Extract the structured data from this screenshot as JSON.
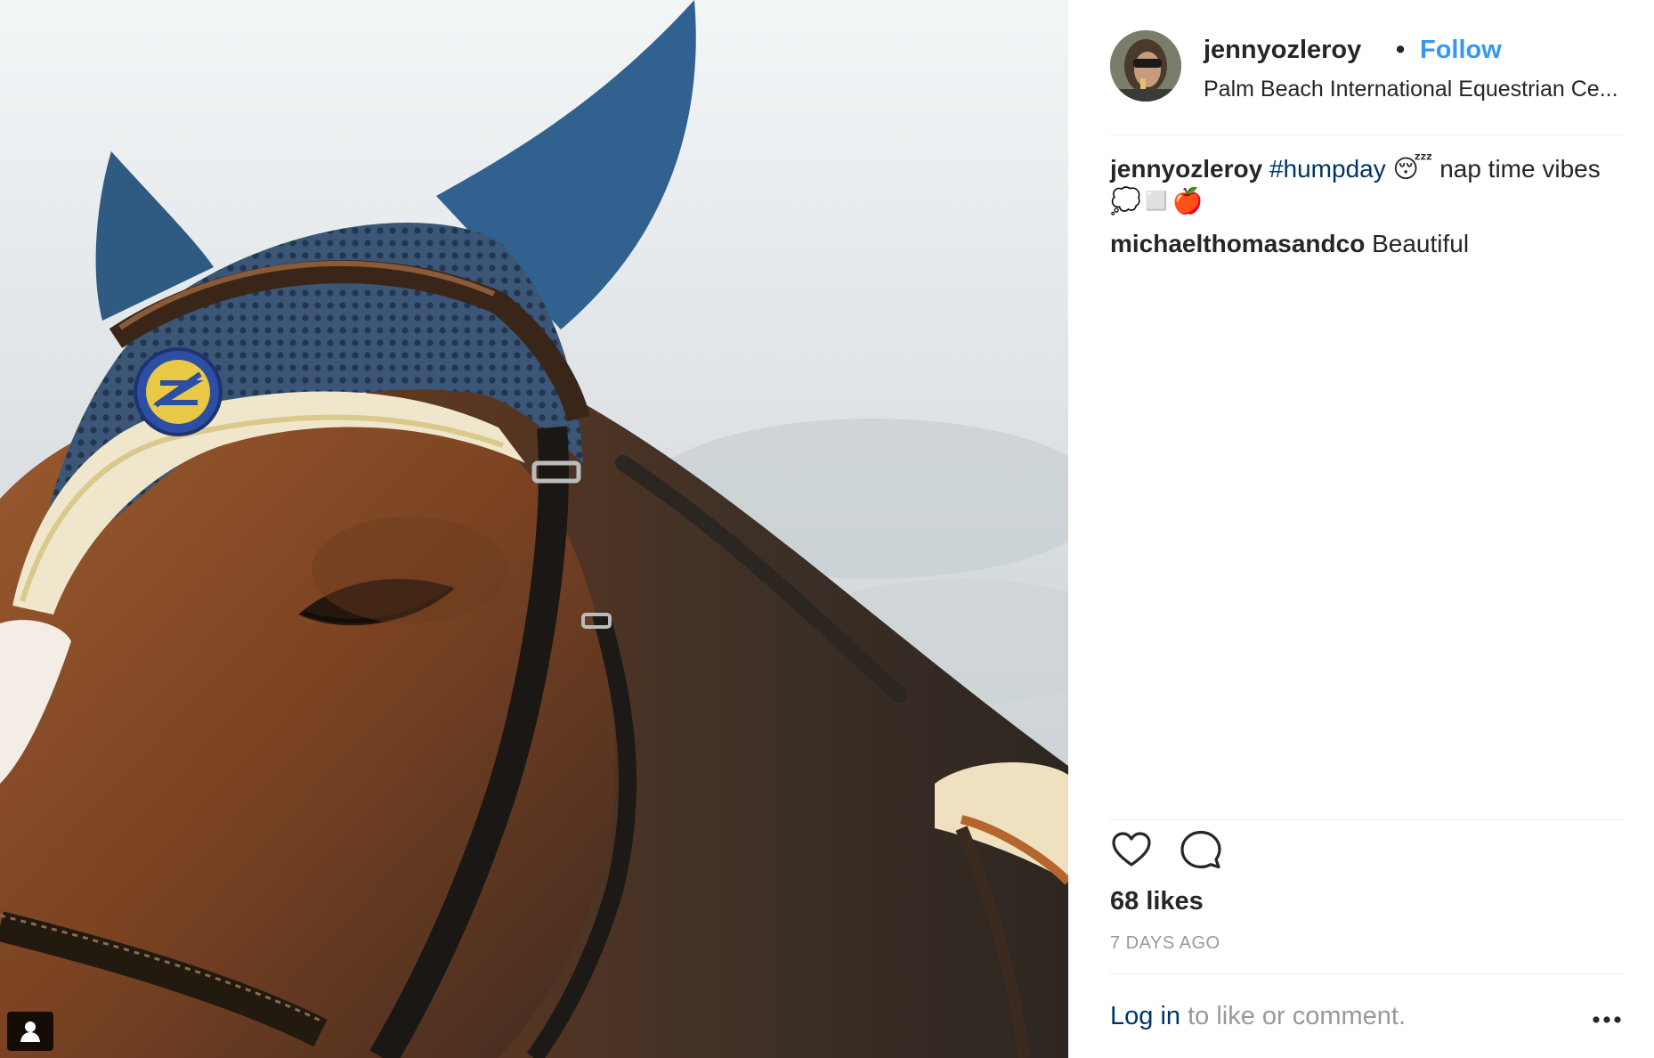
{
  "post": {
    "username": "jennyozleroy",
    "separator": "•",
    "follow_label": "Follow",
    "location": "Palm Beach International Equestrian Ce...",
    "caption": {
      "author": "jennyozleroy",
      "hashtag": "#humpday",
      "text": " 😴 nap time vibes 💭◻️🍎"
    },
    "comments": [
      {
        "author": "michaelthomasandco",
        "text": " Beautiful"
      }
    ],
    "likes": "68 likes",
    "age": "7 DAYS AGO",
    "login_link": "Log in",
    "login_rest": " to like or comment."
  },
  "icons": {
    "like": "heart-icon",
    "comment": "comment-icon",
    "more": "more-options-icon",
    "tagged": "user-tag-icon"
  },
  "colors": {
    "link_blue": "#3897f0",
    "hashtag_blue": "#003569",
    "muted_gray": "#999999",
    "text": "#262626"
  }
}
